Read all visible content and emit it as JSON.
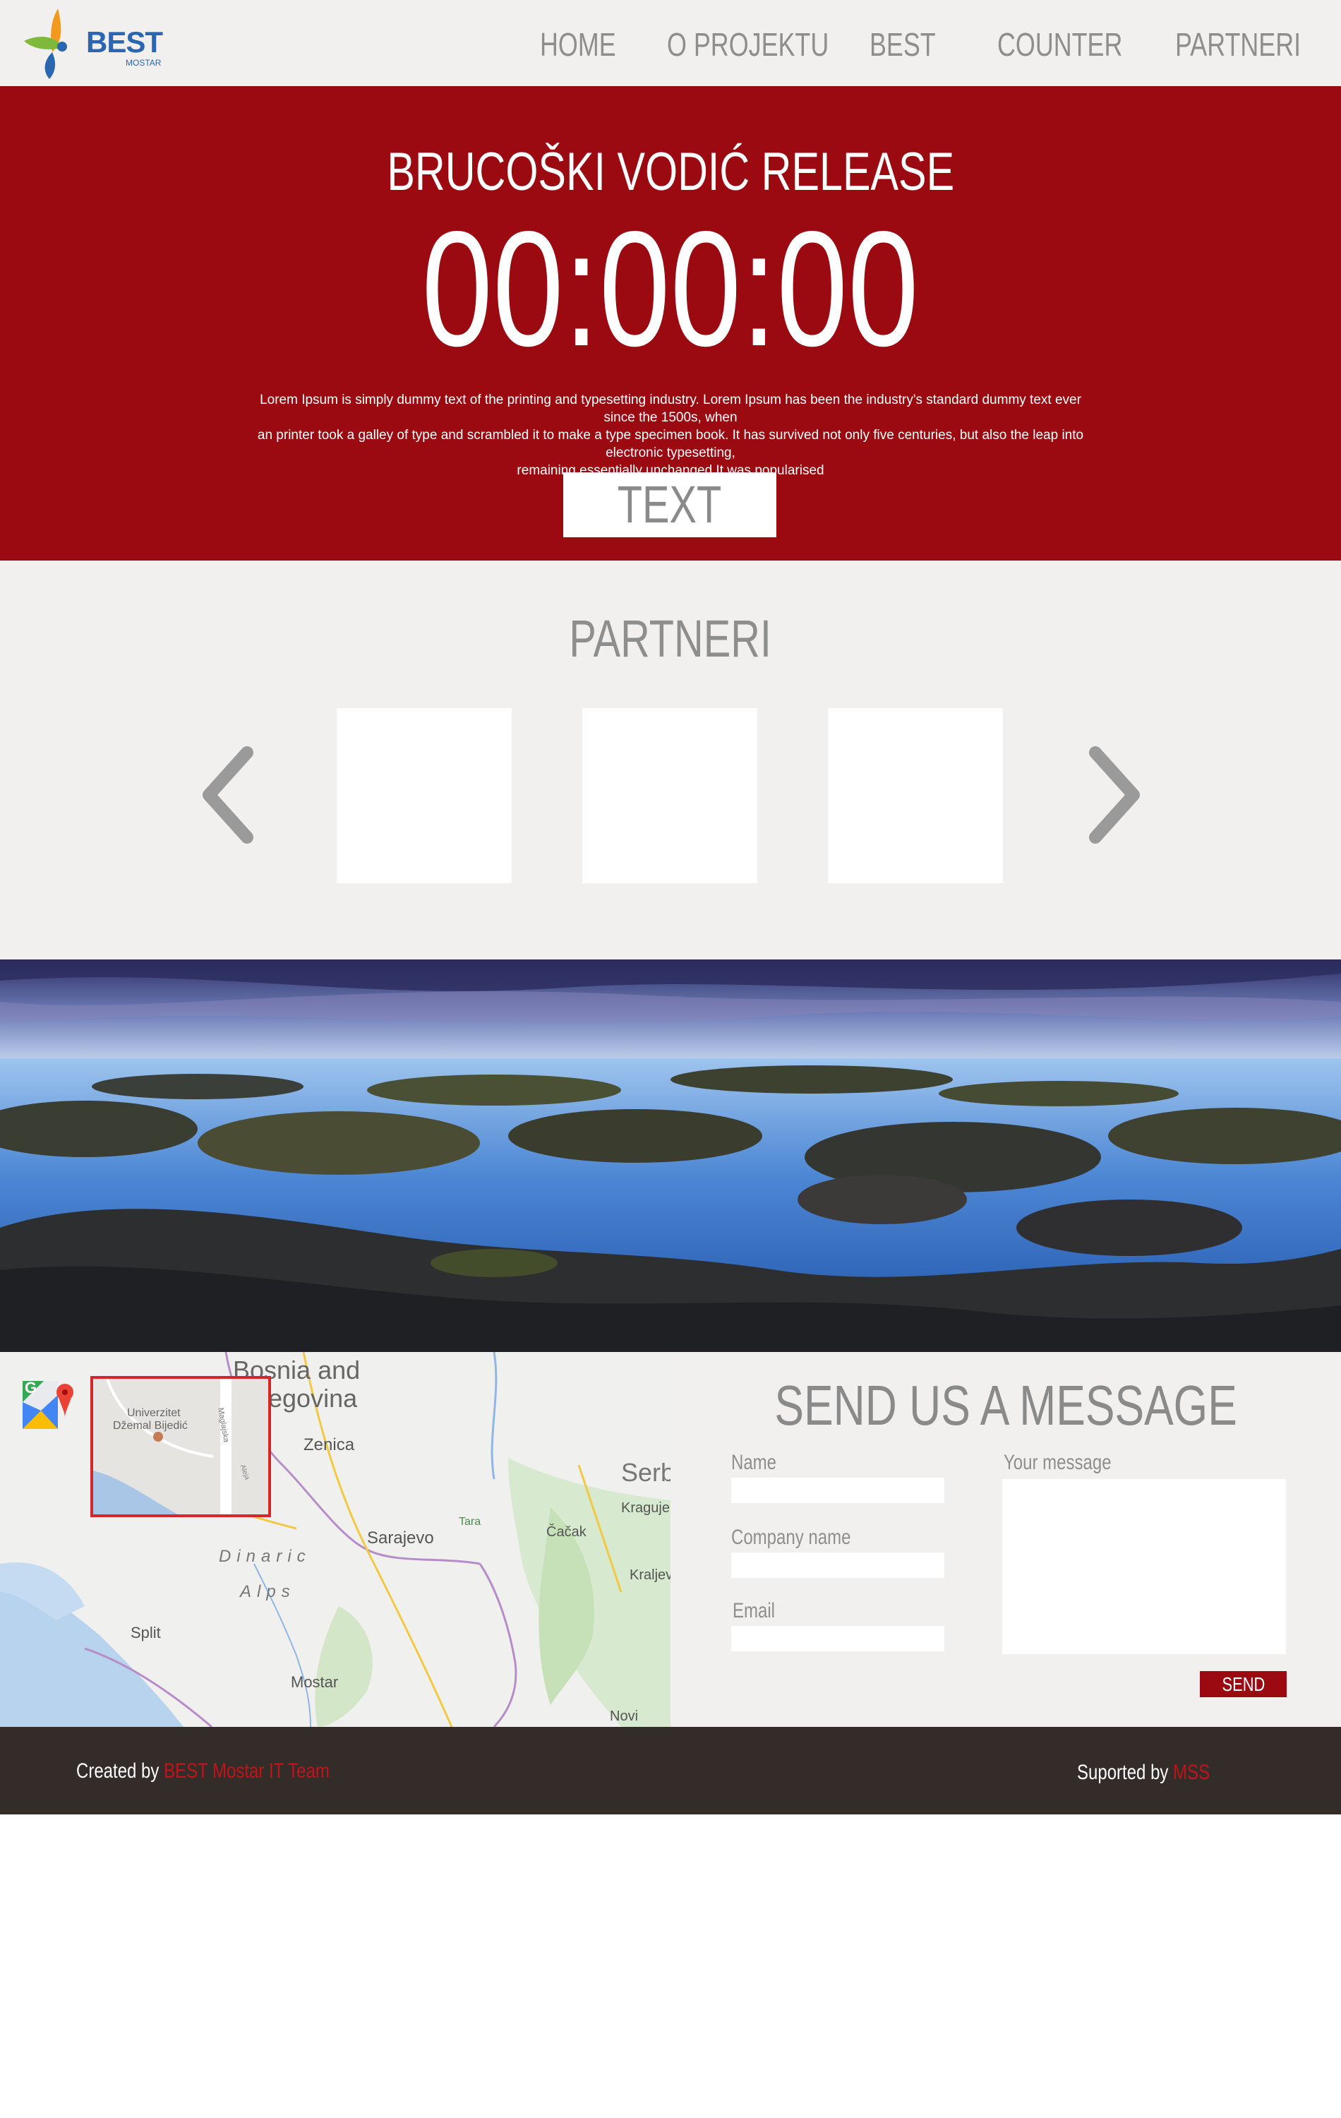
{
  "brand": {
    "logo_word": "BEST",
    "logo_sub": "MOSTAR"
  },
  "nav": {
    "items": [
      {
        "label": "HOME"
      },
      {
        "label": "O PROJEKTU"
      },
      {
        "label": "BEST"
      },
      {
        "label": "COUNTER"
      },
      {
        "label": "PARTNERI"
      }
    ]
  },
  "hero": {
    "title": "BRUCOŠKI VODIĆ RELEASE",
    "countdown": "00:00:00",
    "text_line1": "Lorem Ipsum is simply dummy text of the printing and typesetting industry. Lorem Ipsum has been the industry's standard dummy text ever since the 1500s, when",
    "text_line2": "an printer took a galley of type and scrambled it to make a type specimen book. It has survived not only five centuries, but also the leap into electronic typesetting,",
    "text_line3": "remaining essentially unchanged  It was popularised",
    "button_label": "TEXT"
  },
  "partners": {
    "title": "PARTNERI"
  },
  "map": {
    "labels": {
      "bosnia": "Bosnia and",
      "herzegovina": "egovina",
      "zenica": "Zenica",
      "sarajevo": "Sarajevo",
      "dinaric": "Dinaric",
      "alps": "Alps",
      "split": "Split",
      "mostar": "Mostar",
      "serbia": "Serbi",
      "kragujevac": "Kraguje",
      "cacak": "Čačak",
      "kraljevo": "Kraljev",
      "tara": "Tara",
      "novi": "Novi",
      "university_1": "Univerzitet",
      "university_2": "Džemal Bijedić",
      "street_1": "Maglajska",
      "street_2": "Aleja"
    },
    "badge_letter": "G"
  },
  "contact": {
    "title": "SEND US A MESSAGE",
    "name_label": "Name",
    "company_label": "Company name",
    "email_label": "Email",
    "message_label": "Your message",
    "submit_label": "SEND"
  },
  "footer": {
    "created_prefix": "Created by ",
    "created_link": "BEST Mostar IT Team",
    "supported_prefix": "Suported by ",
    "supported_link": "MSS"
  },
  "colors": {
    "accent_red": "#9b0a10",
    "nav_bg": "#f1f0ef",
    "footer_bg": "#342c29",
    "link_red": "#c0141a",
    "gray_text": "#8e8e8e"
  }
}
